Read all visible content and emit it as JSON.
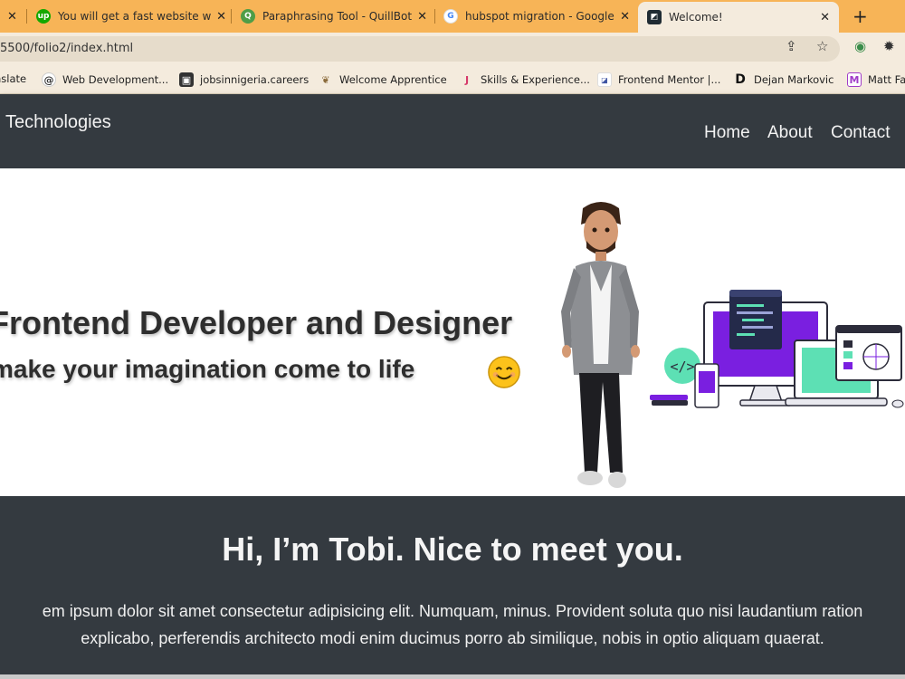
{
  "browser": {
    "tabs": [
      {
        "title": "",
        "favicon": ""
      },
      {
        "title": "You will get a fast website wi",
        "favicon": "up"
      },
      {
        "title": "Paraphrasing Tool - QuillBot",
        "favicon": "Q"
      },
      {
        "title": "hubspot migration - Google",
        "favicon": "G"
      },
      {
        "title": "Welcome!",
        "favicon": ""
      }
    ],
    "new_tab_label": "+",
    "url": "5500/folio2/index.html",
    "bookmarks": [
      {
        "label": "nslate",
        "icon": ""
      },
      {
        "label": "Web Development...",
        "icon": "@"
      },
      {
        "label": "jobsinnigeria.careers",
        "icon": "briefcase"
      },
      {
        "label": "Welcome Apprentice",
        "icon": "ant"
      },
      {
        "label": "Skills & Experience...",
        "icon": "J"
      },
      {
        "label": "Frontend Mentor |...",
        "icon": "FM"
      },
      {
        "label": "Dejan Markovic",
        "icon": "D"
      },
      {
        "label": "Matt Fa",
        "icon": "M"
      }
    ]
  },
  "site": {
    "brand": "Technologies",
    "nav": [
      "Home",
      "About",
      "Contact"
    ],
    "hero": {
      "headline": "Frontend Developer and Designer",
      "subline": "make your imagination come to life"
    },
    "about": {
      "heading": "Hi, I’m Tobi. Nice to meet you.",
      "line1": "em ipsum dolor sit amet consectetur adipisicing elit. Numquam, minus. Provident soluta quo nisi laudantium ration",
      "line2": "explicabo, perferendis architecto modi enim ducimus porro ab similique, nobis in optio aliquam quaerat."
    }
  },
  "colors": {
    "tabstrip": "#f7b457",
    "toolbar": "#f4ebdd",
    "site_dark": "#343a40",
    "accent_purple": "#7a1fe0",
    "accent_mint": "#5de0b4"
  }
}
